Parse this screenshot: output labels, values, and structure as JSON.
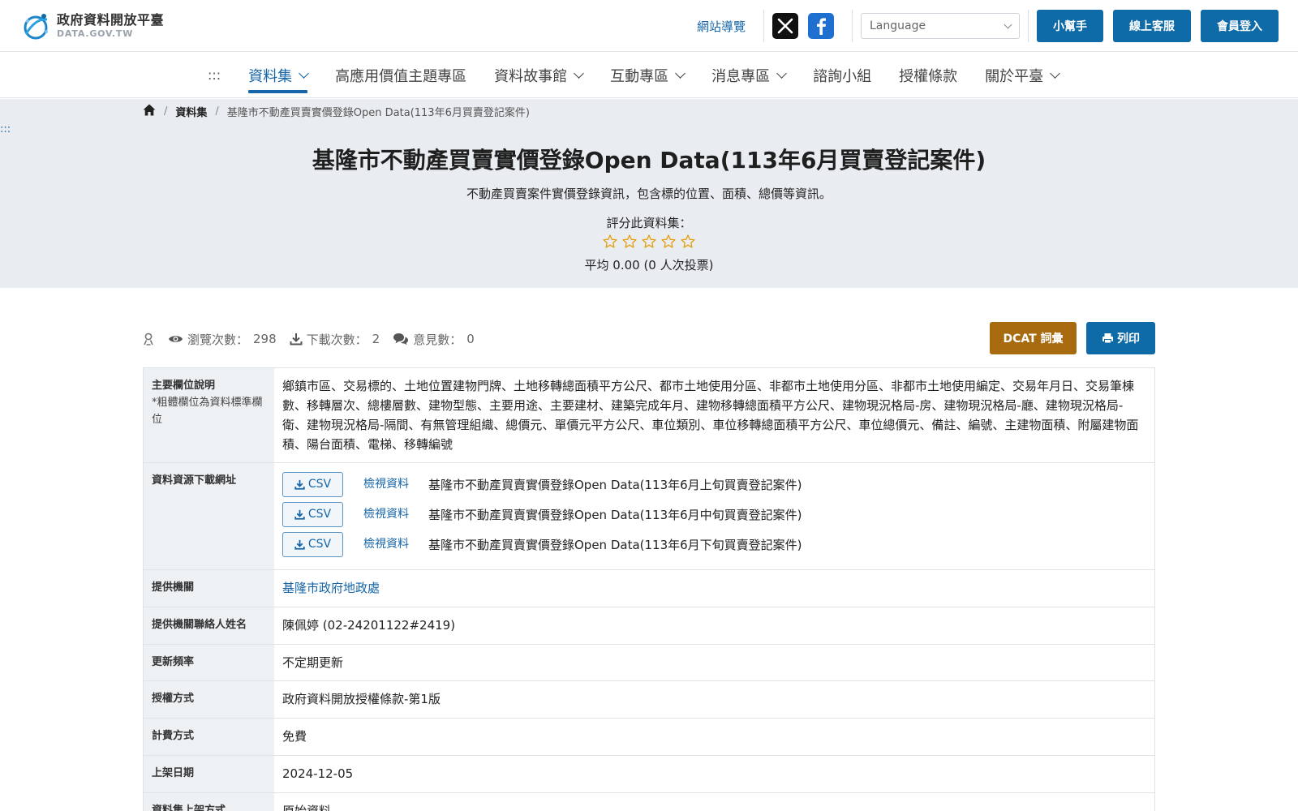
{
  "header": {
    "logo_title": "政府資料開放平臺",
    "logo_sub": "DATA.GOV.TW",
    "sitemap": "網站導覽",
    "language_placeholder": "Language",
    "helper": "小幫手",
    "service": "線上客服",
    "login": "會員登入"
  },
  "nav": {
    "dots": ":::",
    "items": [
      {
        "label": "資料集"
      },
      {
        "label": "高應用價值主題專區"
      },
      {
        "label": "資料故事館"
      },
      {
        "label": "互動專區"
      },
      {
        "label": "消息專區"
      },
      {
        "label": "諮詢小組"
      },
      {
        "label": "授權條款"
      },
      {
        "label": "關於平臺"
      }
    ]
  },
  "breadcrumb": {
    "level1": "資料集",
    "current": "基隆市不動產買賣實價登錄Open Data(113年6月買賣登記案件)"
  },
  "side_dots": ":::",
  "hero": {
    "title": "基隆市不動產買賣實價登錄Open Data(113年6月買賣登記案件)",
    "description": "不動產買賣案件實價登錄資訊，包含標的位置、面積、總價等資訊。",
    "rate_label": "評分此資料集：",
    "rating": 0,
    "rating_max": 5,
    "average": "平均 0.00 (0 人次投票)"
  },
  "stats": {
    "views_label": "瀏覽次數：",
    "views": "298",
    "downloads_label": "下載次數：",
    "downloads": "2",
    "comments_label": "意見數：",
    "comments": "0"
  },
  "actions": {
    "dcat": "DCAT 詞彙",
    "print": "列印"
  },
  "fields": {
    "main_label": "主要欄位說明",
    "main_note": "*粗體欄位為資料標準欄位",
    "main_value": "鄉鎮市區、交易標的、土地位置建物門牌、土地移轉總面積平方公尺、都市土地使用分區、非都市土地使用分區、非都市土地使用編定、交易年月日、交易筆棟數、移轉層次、總樓層數、建物型態、主要用途、主要建材、建築完成年月、建物移轉總面積平方公尺、建物現況格局-房、建物現況格局-廳、建物現況格局-衛、建物現況格局-隔間、有無管理組織、總價元、單價元平方公尺、車位類別、車位移轉總面積平方公尺、車位總價元、備註、編號、主建物面積、附屬建物面積、陽台面積、電梯、移轉編號",
    "resources_label": "資料資源下載網址",
    "resources": [
      {
        "format": "CSV",
        "view": "檢視資料",
        "name": "基隆市不動產買賣實價登錄Open Data(113年6月上旬買賣登記案件)"
      },
      {
        "format": "CSV",
        "view": "檢視資料",
        "name": "基隆市不動產買賣實價登錄Open Data(113年6月中旬買賣登記案件)"
      },
      {
        "format": "CSV",
        "view": "檢視資料",
        "name": "基隆市不動產買賣實價登錄Open Data(113年6月下旬買賣登記案件)"
      }
    ],
    "provider_label": "提供機關",
    "provider": "基隆市政府地政處",
    "contact_label": "提供機關聯絡人姓名",
    "contact": "陳佩婷 (02-24201122#2419)",
    "frequency_label": "更新頻率",
    "frequency": "不定期更新",
    "license_label": "授權方式",
    "license": "政府資料開放授權條款-第1版",
    "fee_label": "計費方式",
    "fee": "免費",
    "date_label": "上架日期",
    "date": "2024-12-05",
    "method_label": "資料集上架方式",
    "method": "原始資料"
  },
  "colors": {
    "primary": "#0f6aa8",
    "gold": "#a86a0e",
    "hero_bg": "#e9edf1",
    "star": "#e2a010"
  }
}
